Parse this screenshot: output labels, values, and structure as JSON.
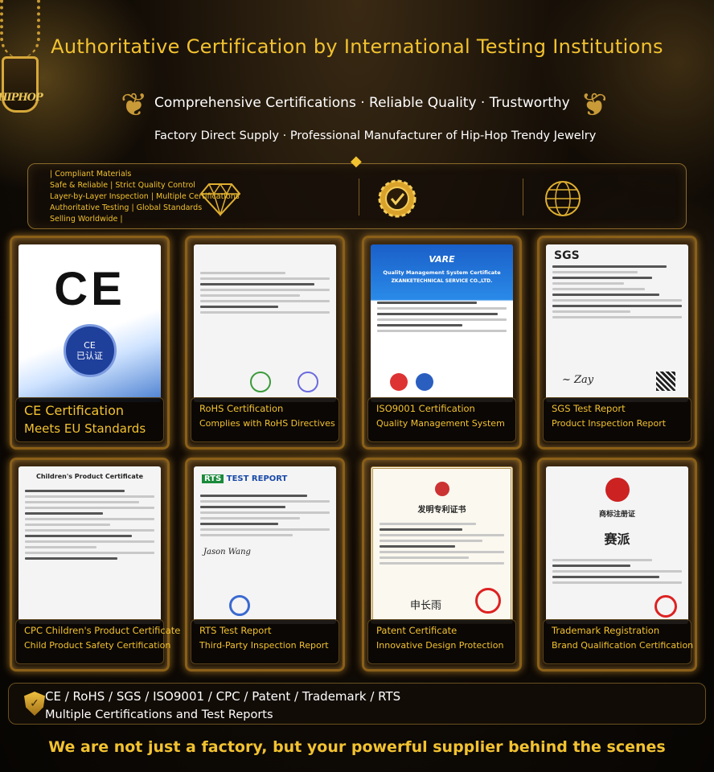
{
  "header": {
    "title": "Authoritative Certification by International Testing Institutions",
    "subtitle1": "Comprehensive Certifications · Reliable Quality · Trustworthy",
    "subtitle2": "Factory Direct Supply · Professional Manufacturer of Hip-Hop Trendy Jewelry",
    "logo_text": "HIPHOP"
  },
  "features": {
    "lines": [
      [
        "| Compliant Materials"
      ],
      [
        "Safe & Reliable",
        " | Strict Quality Control"
      ],
      [
        "Layer-by-Layer Inspection",
        " | Multiple Certifications"
      ],
      [
        "Authoritative Testing",
        " | Global Standards"
      ],
      [
        "Selling Worldwide |"
      ]
    ],
    "icons": [
      "diamond-icon",
      "quality-badge-icon",
      "globe-icon"
    ]
  },
  "cards": [
    {
      "title": "CE Certification",
      "subtitle": "Meets EU Standards",
      "doc_mark": "CE",
      "seal_text": "CE\n已认证"
    },
    {
      "title": "RoHS Certification",
      "subtitle": "Complies with RoHS Directives"
    },
    {
      "title": "ISO9001 Certification",
      "subtitle": "Quality Management System",
      "doc_mark": "VARE",
      "doc_header": "Quality Management System Certificate",
      "doc_company": "ZKANKETECHNICAL SERVICE CO.,LTD."
    },
    {
      "title": "SGS Test Report",
      "subtitle": "Product Inspection Report",
      "doc_mark": "SGS"
    },
    {
      "title": "CPC Children's Product Certificate",
      "subtitle": "Child Product Safety Certification",
      "doc_header": "Children's Product Certificate"
    },
    {
      "title": "RTS Test Report",
      "subtitle": "Third-Party Inspection Report",
      "doc_mark": "RTS",
      "doc_header": "TEST REPORT"
    },
    {
      "title": "Patent Certificate",
      "subtitle": "Innovative Design Protection",
      "doc_header": "发明专利证书"
    },
    {
      "title": "Trademark Registration",
      "subtitle": "Brand Qualification Certification",
      "doc_header": "商标注册证",
      "doc_brand": "赛派"
    }
  ],
  "bottom_bar": {
    "line1": "CE / RoHS / SGS / ISO9001 / CPC / Patent / Trademark / RTS",
    "line2": "Multiple Certifications and Test Reports"
  },
  "footer": "We are not just a factory, but your powerful supplier behind the scenes",
  "colors": {
    "accent": "#f2c230",
    "gold_border": "#8a5f18",
    "background": "#0a0704"
  }
}
